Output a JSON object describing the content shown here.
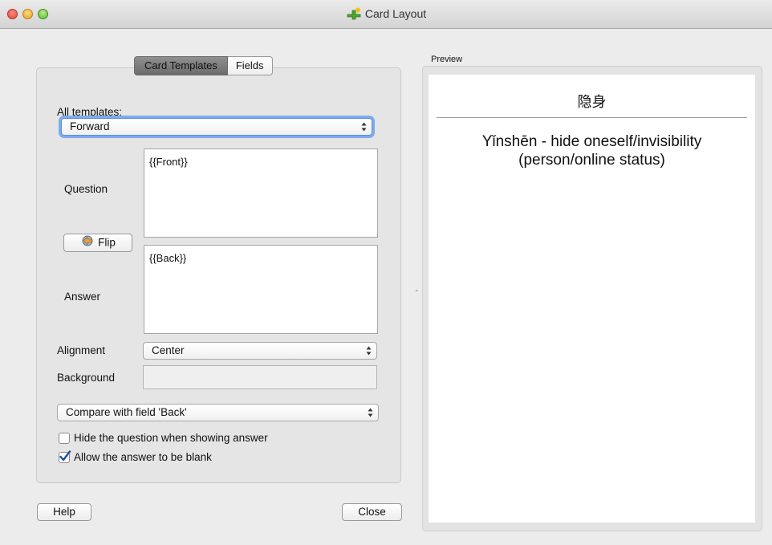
{
  "window": {
    "title": "Card Layout",
    "icon": "anki-plus-icon"
  },
  "tabs": [
    {
      "label": "Card Templates",
      "active": true
    },
    {
      "label": "Fields",
      "active": false
    }
  ],
  "form": {
    "all_templates_label": "All templates:",
    "template_value": "Forward",
    "question_label": "Question",
    "question_value": "{{Front}}",
    "flip_label": "Flip",
    "answer_label": "Answer",
    "answer_value": "{{Back}}",
    "alignment_label": "Alignment",
    "alignment_value": "Center",
    "background_label": "Background",
    "compare_value": "Compare with field 'Back'",
    "hide_question_label": "Hide the question when showing answer",
    "hide_question_checked": false,
    "allow_blank_label": "Allow the answer to be blank",
    "allow_blank_checked": true
  },
  "buttons": {
    "help": "Help",
    "close": "Close"
  },
  "preview": {
    "label": "Preview",
    "question": "隐身",
    "answer_line1": "Yǐnshēn - hide oneself/invisibility",
    "answer_line2": "(person/online status)"
  },
  "colors": {
    "accent_focus": "#7eaaf0",
    "checkmark": "#1f4f9e"
  }
}
